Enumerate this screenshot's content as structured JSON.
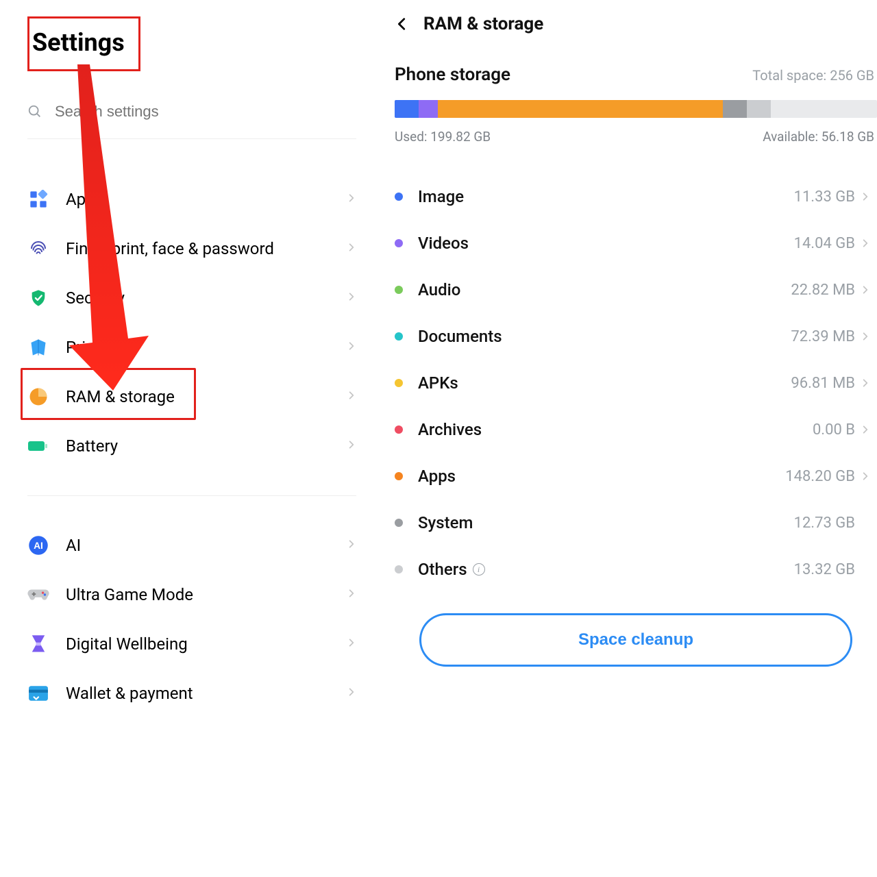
{
  "left": {
    "title": "Settings",
    "search_placeholder": "Search settings",
    "menu": [
      {
        "key": "apps",
        "label": "Apps"
      },
      {
        "key": "biometrics",
        "label": "Fingerprint, face & password"
      },
      {
        "key": "security",
        "label": "Security"
      },
      {
        "key": "privacy",
        "label": "Privacy"
      },
      {
        "key": "ram-storage",
        "label": "RAM & storage",
        "highlighted": true
      },
      {
        "key": "battery",
        "label": "Battery"
      }
    ],
    "menu_group2": [
      {
        "key": "ai",
        "label": "AI"
      },
      {
        "key": "ultra-game-mode",
        "label": "Ultra Game Mode"
      },
      {
        "key": "digital-wellbeing",
        "label": "Digital Wellbeing"
      },
      {
        "key": "wallet-payment",
        "label": "Wallet & payment"
      }
    ]
  },
  "right": {
    "title": "RAM & storage",
    "storage": {
      "section_title": "Phone storage",
      "total_label": "Total space: 256 GB",
      "used_label": "Used: 199.82 GB",
      "available_label": "Available: 56.18 GB",
      "segments": [
        {
          "color": "#3D73F5",
          "pct": 5
        },
        {
          "color": "#8E6BF5",
          "pct": 4
        },
        {
          "color": "#F59C28",
          "pct": 59
        },
        {
          "color": "#9A9DA1",
          "pct": 5
        },
        {
          "color": "#CBCDD0",
          "pct": 5
        }
      ]
    },
    "categories": [
      {
        "dot": "#3D73F5",
        "name": "Image",
        "size": "11.33 GB",
        "chevron": true
      },
      {
        "dot": "#8E6BF5",
        "name": "Videos",
        "size": "14.04 GB",
        "chevron": true
      },
      {
        "dot": "#7BCB5C",
        "name": "Audio",
        "size": "22.82 MB",
        "chevron": true
      },
      {
        "dot": "#25C4C9",
        "name": "Documents",
        "size": "72.39 MB",
        "chevron": true
      },
      {
        "dot": "#F5C531",
        "name": "APKs",
        "size": "96.81 MB",
        "chevron": true
      },
      {
        "dot": "#EF4D62",
        "name": "Archives",
        "size": "0.00 B",
        "chevron": true
      },
      {
        "dot": "#F5841F",
        "name": "Apps",
        "size": "148.20 GB",
        "chevron": true
      },
      {
        "dot": "#9A9DA1",
        "name": "System",
        "size": "12.73 GB",
        "chevron": false
      },
      {
        "dot": "#CBCDD0",
        "name": "Others",
        "size": "13.32 GB",
        "chevron": false,
        "info": true
      }
    ],
    "cleanup_label": "Space cleanup"
  }
}
